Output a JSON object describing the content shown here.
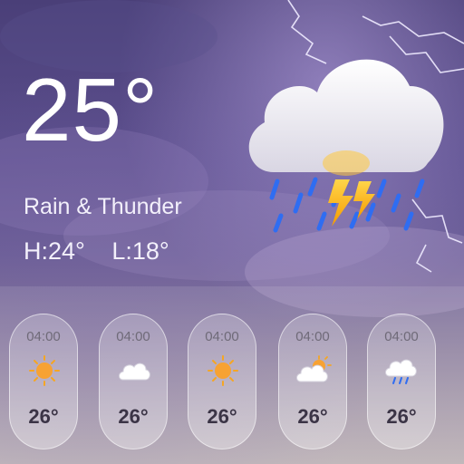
{
  "current": {
    "temperature": "25°",
    "condition": "Rain & Thunder",
    "high": "H:24°",
    "low": "L:18°",
    "icon": "cloud-rain-thunder-icon"
  },
  "hourly": [
    {
      "time": "04:00",
      "temp": "26°",
      "icon": "sun-icon"
    },
    {
      "time": "04:00",
      "temp": "26°",
      "icon": "cloud-icon"
    },
    {
      "time": "04:00",
      "temp": "26°",
      "icon": "sun-icon"
    },
    {
      "time": "04:00",
      "temp": "26°",
      "icon": "partly-cloudy-icon"
    },
    {
      "time": "04:00",
      "temp": "26°",
      "icon": "rain-cloud-icon"
    }
  ],
  "colors": {
    "sun": "#f5a623",
    "rain": "#2f6df2",
    "bolt": "#ffb300"
  }
}
